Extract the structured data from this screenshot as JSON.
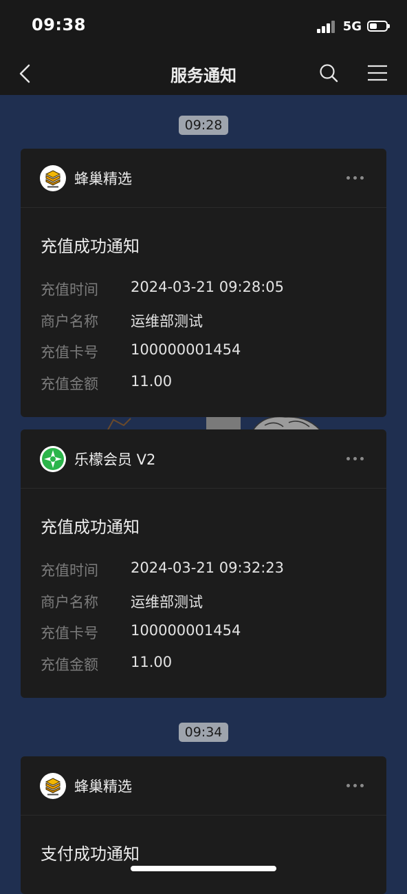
{
  "status_bar": {
    "time": "09:38",
    "network": "5G",
    "battery_level": 0.45
  },
  "nav": {
    "title": "服务通知",
    "icons": [
      "back-icon",
      "search-icon",
      "menu-icon"
    ]
  },
  "messages": [
    {
      "timestamp": "09:28",
      "cards": [
        {
          "sender": "蜂巢精选",
          "avatar_icon": "hive-logo-icon",
          "title": "充值成功通知",
          "rows": [
            {
              "label": "充值时间",
              "value": "2024-03-21 09:28:05"
            },
            {
              "label": "商户名称",
              "value": "运维部测试"
            },
            {
              "label": "充值卡号",
              "value": "100000001454"
            },
            {
              "label": "充值金额",
              "value": "11.00"
            }
          ]
        },
        {
          "sender": "乐檬会员 V2",
          "avatar_icon": "lemon-logo-icon",
          "title": "充值成功通知",
          "rows": [
            {
              "label": "充值时间",
              "value": "2024-03-21 09:32:23"
            },
            {
              "label": "商户名称",
              "value": "运维部测试"
            },
            {
              "label": "充值卡号",
              "value": "100000001454"
            },
            {
              "label": "充值金额",
              "value": "11.00"
            }
          ]
        }
      ]
    },
    {
      "timestamp": "09:34",
      "cards": [
        {
          "sender": "蜂巢精选",
          "avatar_icon": "hive-logo-icon",
          "title": "支付成功通知",
          "rows": []
        }
      ]
    }
  ],
  "colors": {
    "background": "#1f2f50",
    "card": "#1c1c1c",
    "bar": "#191919",
    "label": "#7c7c7c",
    "timestamp_bg": "#9ea4ad"
  }
}
